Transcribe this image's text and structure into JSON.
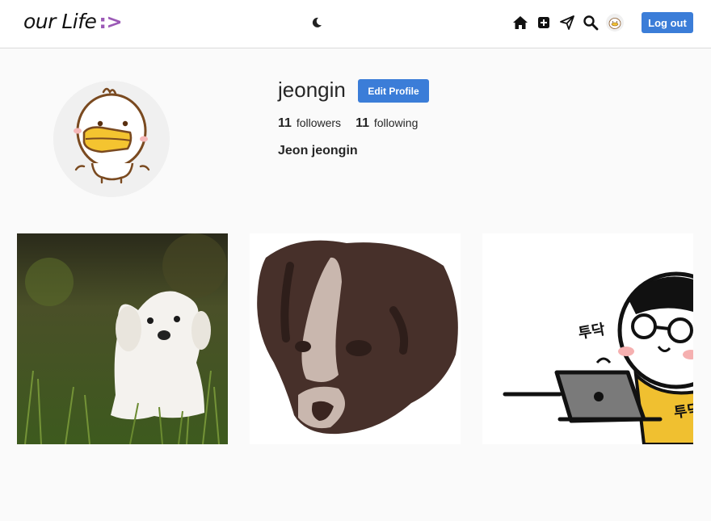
{
  "header": {
    "logo_text": "our Life",
    "logo_smile": ":>",
    "theme_icon": "moon-icon",
    "icons": [
      "home-icon",
      "add-post-icon",
      "send-icon",
      "search-icon"
    ],
    "logout_label": "Log out"
  },
  "profile": {
    "username": "jeongin",
    "edit_label": "Edit Profile",
    "followers_count": "11",
    "followers_label": "followers",
    "following_count": "11",
    "following_label": "following",
    "full_name": "Jeon jeongin"
  },
  "posts": [
    {
      "subject": "white puppy in grass photo"
    },
    {
      "subject": "brown dog illustration"
    },
    {
      "subject": "cartoon character typing on laptop",
      "text_left": "투닥",
      "text_right": "투닥"
    }
  ],
  "colors": {
    "accent": "#3b7dd8",
    "logo_accent": "#9b59b6"
  }
}
